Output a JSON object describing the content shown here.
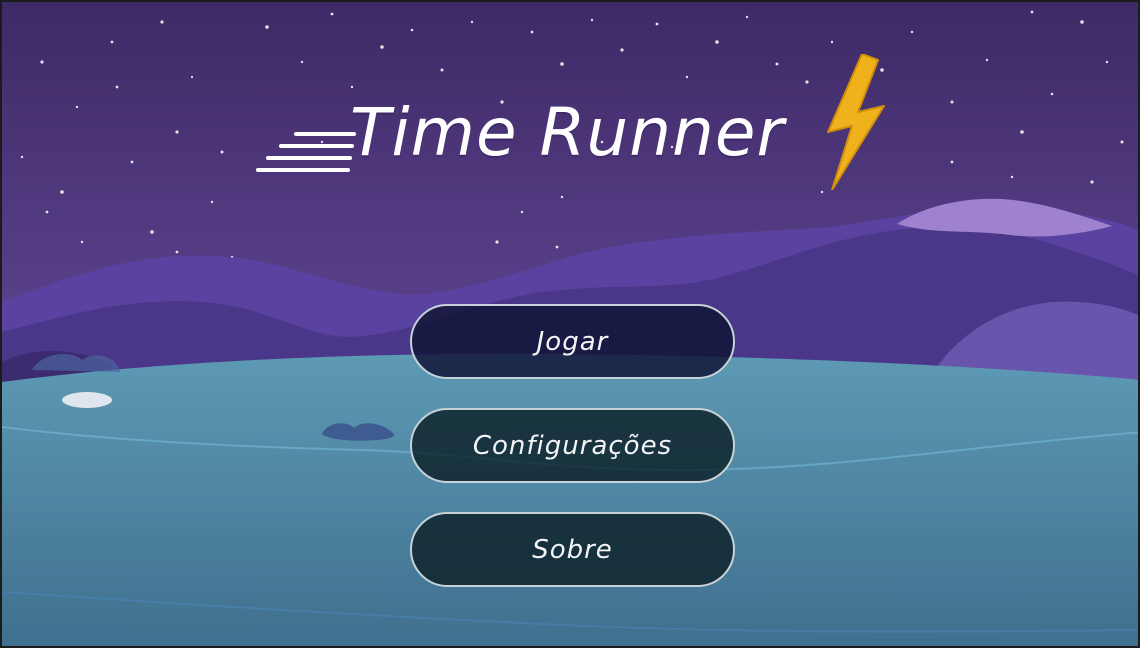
{
  "game": {
    "title": "Time Runner"
  },
  "menu": {
    "play_label": "Jogar",
    "settings_label": "Configurações",
    "about_label": "Sobre"
  },
  "icons": {
    "title_decoration": "lightning-bolt-icon",
    "title_motion": "speed-lines-icon"
  },
  "colors": {
    "sky_top": "#4a3475",
    "sky_bottom": "#7a5aa6",
    "mountains": "#4f3a8c",
    "lake": "#4e86a2",
    "bolt": "#f0b21c",
    "button_bg": "#0a1e26",
    "button_border": "#c6d2d8"
  }
}
